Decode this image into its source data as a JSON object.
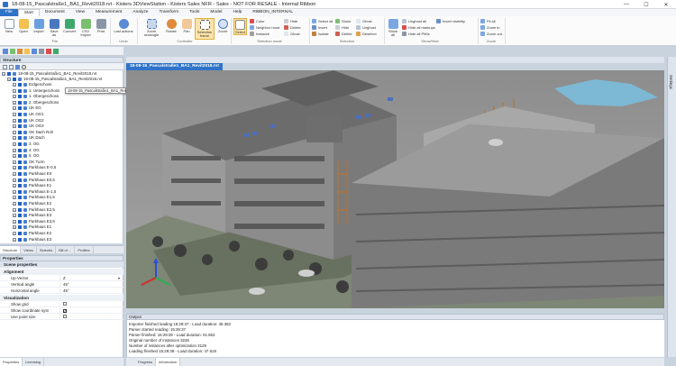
{
  "window": {
    "title": "18-08-15_Pascalstraße1_BA1_Revit2018.rvt - Kisters 3DViewStation - Kisters Sales NFR - Sales - NOT FOR RESALE - Internal Ribbon"
  },
  "menu": [
    "File",
    "Start",
    "Document",
    "View",
    "Measurement",
    "Analyze",
    "Transform",
    "Tools",
    "Model",
    "Help",
    "RIBBON_INTERNAL"
  ],
  "ribbon": {
    "file_group": {
      "label": "File",
      "buttons": [
        "New",
        "Open",
        "Import",
        "Save as",
        "Convert",
        "CSV Import",
        "Print"
      ]
    },
    "undo_group": {
      "label": "Undo",
      "buttons": [
        "Last actions"
      ]
    },
    "controller_group": {
      "label": "Controller",
      "buttons": [
        "Zoom rectangle",
        "Rotate",
        "Pan",
        "Selection frame",
        "Zoom"
      ]
    },
    "selection_mode_group": {
      "label": "Selection mode",
      "buttons": [
        "Select"
      ],
      "small": [
        "Color",
        "Neighbor hood",
        "Instance",
        "Hide",
        "Delete",
        "Ghost"
      ]
    },
    "selection_group": {
      "label": "Selection",
      "small": [
        "Select all",
        "Invert",
        "Isolate",
        "Show",
        "Hide",
        "Delete",
        "Ghost",
        "Unghost",
        "Deselect"
      ]
    },
    "show_hide_group": {
      "label": "Show/Hide",
      "buttons": [
        "Show all"
      ],
      "small": [
        "Unghost all",
        "Hide all markups",
        "Hide all PMIs",
        "Invert visibility"
      ]
    },
    "zoom_group": {
      "label": "Zoom",
      "small": [
        "Fit all",
        "Zoom in",
        "Zoom out"
      ]
    }
  },
  "structure": {
    "title": "Structure",
    "tooltip": "18-08-15_Pascalstraße1_BA1_Revit2018.rvt",
    "root": "18-08-15_Pascalstraße1_BA1_Revit2018.rvt",
    "child": "18-08-15_Pascalstraße1_BA1_Revit2018.rvt",
    "items": [
      "Erdgeschoss",
      "1. Untergeschoss",
      "1. Obergeschoss",
      "2. Obergeschoss",
      "UK EG",
      "UK OG1",
      "UK OG2",
      "UK OG3",
      "OK Dach Roh",
      "UK Dach",
      "3. OG",
      "4. OG",
      "5. OG",
      "OK Turm",
      "Parkhaus E-0,5",
      "Parkhaus E0",
      "Parkhaus E0,5",
      "Parkhaus E1",
      "Parkhaus E-1,5",
      "Parkhaus E1,5",
      "Parkhaus E2",
      "Parkhaus E2,5",
      "Parkhaus E3",
      "Parkhaus E3,5",
      "Parkhaus E1",
      "Parkhaus E2",
      "Parkhaus E3",
      "Parkhaus E4"
    ]
  },
  "left_tabs": [
    "Structure",
    "Views",
    "Selectio",
    "Bill of ...",
    "Profiles"
  ],
  "properties": {
    "title": "Properties",
    "scene_header": "Scene properties",
    "alignment_group": "Alignment",
    "rows_alignment": [
      {
        "key": "Up-Vector",
        "value": "Z"
      },
      {
        "key": "Vertical angle",
        "value": "45°"
      },
      {
        "key": "Horizontal angle",
        "value": "45°"
      }
    ],
    "visualization_group": "Visualization",
    "rows_visualization": [
      {
        "key": "Show grid",
        "value": ""
      },
      {
        "key": "Show coordinate syst",
        "value": ""
      },
      {
        "key": "Use point size",
        "value": ""
      }
    ]
  },
  "bottom_left_tabs": [
    "Properties",
    "Licensing"
  ],
  "viewport": {
    "tab": "18-08-15_Pascalstraße1_BA1_Revit2018.rvt",
    "right_tab": "Settings"
  },
  "output": {
    "title": "Output",
    "lines": [
      "Importer finished loading 15:29:37 - Load duration: 45.382",
      "Parser started reading: 15:29:37",
      "Parser finished: 15:29:39 - Load duration: 01.563",
      "Original number of instances 3226",
      "Number of instances after optimization 3129",
      "Loading finished 15:29:39 - Load duration: 47.618"
    ],
    "tabs": [
      "Progress",
      "Information"
    ]
  },
  "colors": {
    "accent": "#2e73c9",
    "panel": "#dde4ee"
  }
}
